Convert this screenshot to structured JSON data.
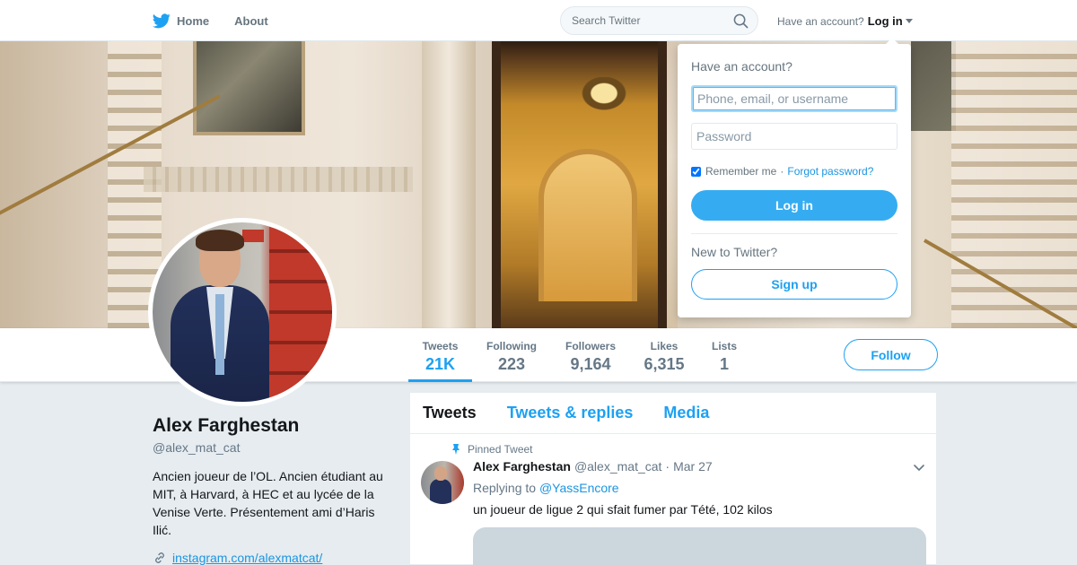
{
  "colors": {
    "accent": "#1da1f2",
    "link": "#1b95e0",
    "background": "#e6ecf0",
    "text": "#14171a",
    "muted": "#657786"
  },
  "nav": {
    "home_label": "Home",
    "about_label": "About",
    "search_placeholder": "Search Twitter",
    "account_prompt": "Have an account?",
    "login_label": "Log in"
  },
  "login_dropdown": {
    "title": "Have an account?",
    "username_placeholder": "Phone, email, or username",
    "password_placeholder": "Password",
    "remember_label": "Remember me",
    "separator": "·",
    "forgot_label": "Forgot password?",
    "login_button": "Log in",
    "new_prompt": "New to Twitter?",
    "signup_button": "Sign up"
  },
  "profile_nav": {
    "stats": [
      {
        "label": "Tweets",
        "value": "21K",
        "active": true
      },
      {
        "label": "Following",
        "value": "223"
      },
      {
        "label": "Followers",
        "value": "9,164"
      },
      {
        "label": "Likes",
        "value": "6,315"
      },
      {
        "label": "Lists",
        "value": "1"
      }
    ],
    "follow_button": "Follow"
  },
  "profile": {
    "name": "Alex Farghestan",
    "handle": "@alex_mat_cat",
    "bio": "Ancien joueur de l’OL. Ancien étudiant au MIT, à Harvard, à HEC et au lycée de la Venise Verte. Présentement ami d’Haris Ilić.",
    "link": "instagram.com/alexmatcat/"
  },
  "timeline": {
    "tabs": [
      "Tweets",
      "Tweets & replies",
      "Media"
    ],
    "tweet": {
      "pinned_label": "Pinned Tweet",
      "author": "Alex Farghestan",
      "handle": "@alex_mat_cat",
      "dot": "·",
      "date": "Mar 27",
      "replying_prefix": "Replying to",
      "replying_to": "@YassEncore",
      "text": "un joueur de ligue 2 qui sfait fumer par Tété, 102 kilos"
    }
  },
  "icons": {
    "logo": "twitter-bird-icon",
    "search": "search-icon",
    "pin": "pin-icon",
    "link": "link-icon",
    "chevron": "chevron-down-icon"
  }
}
